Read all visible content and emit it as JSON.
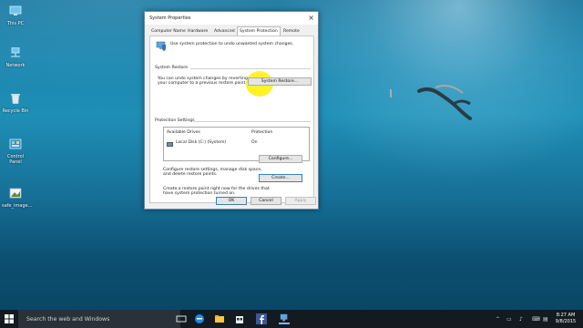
{
  "desktop": {
    "icons": [
      {
        "label": "This PC",
        "icon": "computer-icon"
      },
      {
        "label": "Network",
        "icon": "network-icon"
      },
      {
        "label": "Recycle Bin",
        "icon": "recycle-bin-icon"
      },
      {
        "label": "Control Panel",
        "icon": "control-panel-icon"
      },
      {
        "label": "safe_image...",
        "icon": "image-file-icon"
      }
    ]
  },
  "dialog": {
    "title": "System Properties",
    "close_glyph": "×",
    "tabs": [
      "Computer Name",
      "Hardware",
      "Advanced",
      "System Protection",
      "Remote"
    ],
    "active_tab": "System Protection",
    "intro": "Use system protection to undo unwanted system changes.",
    "restore": {
      "heading": "System Restore",
      "description_line1": "You can undo system changes by reverting",
      "description_line2": "your computer to a previous restore point.",
      "button": "System Restore..."
    },
    "protection": {
      "heading": "Protection Settings",
      "col_drives": "Available Drives",
      "col_protection": "Protection",
      "drives": [
        {
          "name": "Local Disk (C:) (System)",
          "protection": "On"
        }
      ],
      "configure_line1": "Configure restore settings, manage disk space,",
      "configure_line2": "and delete restore points.",
      "configure_button": "Configure...",
      "create_line1": "Create a restore point right now for the drives that",
      "create_line2": "have system protection turned on.",
      "create_button": "Create..."
    },
    "buttons": {
      "ok": "OK",
      "cancel": "Cancel",
      "apply": "Apply"
    }
  },
  "taskbar": {
    "search_placeholder": "Search the web and Windows",
    "time": "8:27 AM",
    "date": "9/8/2015",
    "apps": [
      "task-view-icon",
      "edge-icon",
      "file-explorer-icon",
      "store-icon",
      "facebook-icon",
      "system-properties-icon"
    ]
  },
  "colors": {
    "accent": "#3c7fb1",
    "highlight": "#fff000",
    "taskbar": "#141a1f"
  }
}
